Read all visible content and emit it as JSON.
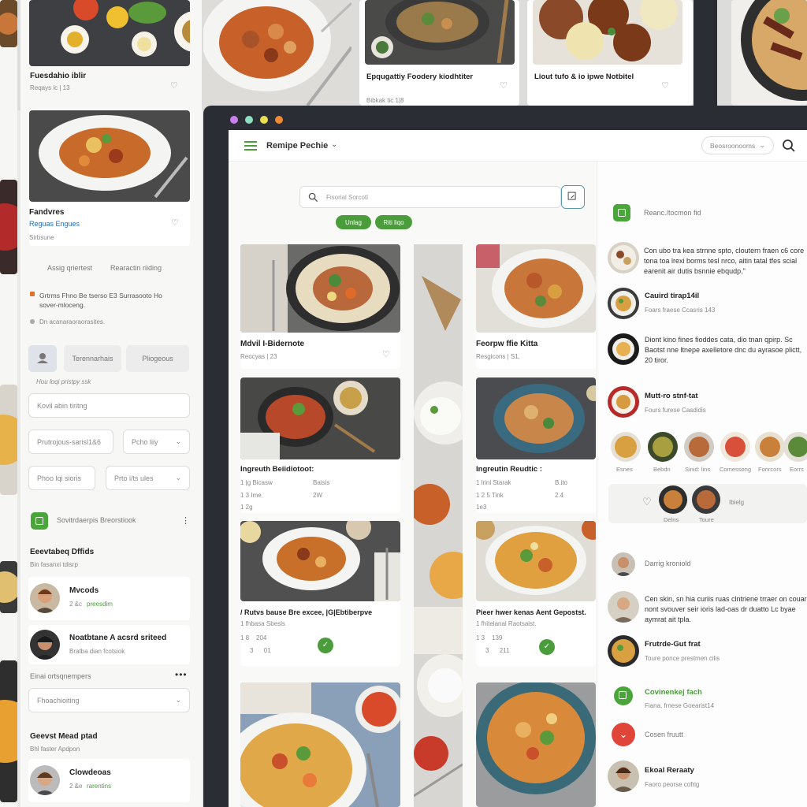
{
  "top_cards": [
    {
      "title": "Fuesdahio iblir",
      "meta": "Reqays ic  |  13"
    },
    {
      "title": "Epqugattiy Foodery kiodhtiter",
      "meta": "Bibkak tic 1|8"
    },
    {
      "title": "Liout tufo & io ipwe Notbitel",
      "meta": ""
    }
  ],
  "left_panel": {
    "card_title": "Fandvres",
    "card_tags": "Reguas  Engues",
    "card_sub": "Sirbsune",
    "tabs": [
      "Assig  qriertest",
      "Rearactin riiding"
    ],
    "line1": "Grtrms Fhno Be tserso E3 Surrasooto Ho sover-mloceng.",
    "line2": "Dn acanaraoraorasites.",
    "btn_a": "Terennarhais",
    "btn_b": "Pliogeous",
    "section_label": "Hou loqi pristpy ssk",
    "input1": "Kovil abin tiritng",
    "select_a": "Prutrojous-sarisl1&6",
    "select_b": "Pcho liiy",
    "select_c": "Phoo lqi sioris",
    "select_d": "Prto i/ts ules",
    "feed_title": "Sovitrdaerpis Breorstiook",
    "section2": "Eeevtabeq Dffids",
    "section2_sub": "Bin fasanxi tdisrp",
    "people": [
      {
        "name": "Mvcods",
        "sub": "2 &c",
        "tag": "preesdim"
      },
      {
        "name": "Noatbtane A acsrd sriteed",
        "sub": "Bratba dian fcotsiok",
        "tag": ""
      }
    ],
    "section3": "Einai ortsqnempers",
    "select_e": "Fhoachioiting",
    "section4": "Geevst Mead ptad",
    "section4_sub": "Bhl faster Apdpon",
    "person3": {
      "name": "Clowdeoas",
      "sub": "2 &e",
      "tag": "rarentins"
    }
  },
  "app": {
    "title": "Remipe Pechie",
    "sort_label": "Beosroonooms",
    "search_placeholder": "Fisorial Sorcotl",
    "filters": [
      "Unlag",
      "Riti liqo"
    ]
  },
  "recipes": [
    {
      "title": "Mdvil I-Bidernote",
      "meta1": "Reocyas  |  23"
    },
    {
      "title": "Feorpw ffie Kitta",
      "meta1": "Resgicons  |  S1,"
    },
    {
      "title": "Ingreuth Beiidiotoot:",
      "l1": "1 |g Bicasw",
      "l2": "1 3     Ime",
      "l3": "1 2g",
      "r1": "Baisis",
      "r2": "2W"
    },
    {
      "title": "Ingreutin Reudtic :",
      "l1": "1 lrinl Starak",
      "l2": "1 2 5     Tink",
      "l3": "1e3",
      "r1": "B.ito",
      "r2": "2.4"
    },
    {
      "title": "/ Rutvs bause Bre excee, |G|Ebtiberpve",
      "l1": "1 fhbasa Sbesls",
      "l2": "1 8    204",
      "l3": "3      01",
      "r1": "",
      "r2": ""
    },
    {
      "title": "Pieer hwer kenas Aent Gepostst.",
      "l1": "1 fhitelanal Raotsaist.",
      "l2": "1 3    139",
      "l3": "3      211",
      "r1": "",
      "r2": ""
    }
  ],
  "right_panel": {
    "header": "Reanc./tocmon fid",
    "comments": [
      {
        "text": "Con ubo tra kea strnne spto, cloutern fraen  c6 core tona toa lrexi borms tesl nrco, aitin tatal tfes scial earenit air dutis bsnnie ebqudp.\""
      },
      {
        "name": "Cauird tirap14il",
        "sub": "Foars  fraese Ccasris 143"
      },
      {
        "text": "Diont kino fines fioddes cata, dio tnan qpirp. Sc Baotst nne ltnepe axelletore dnc du ayrasoe plictt, 20 tiror."
      },
      {
        "name": "Mutt-ro stnf-tat",
        "sub": "Fours  furese Casdidis"
      }
    ],
    "avatar_labels": [
      "Esnes",
      "Bebdn",
      "Sinid: lins",
      "Comessong",
      "Fonrcors",
      "Eorrs"
    ],
    "like_row": [
      "Delns",
      "Toure",
      "Ibielg"
    ],
    "people": [
      {
        "name": "Darrig kroniold",
        "sub": ""
      },
      {
        "text": "Cen skin, sn hia curiis ruas clntriene trraer on couar nont svouver seir ioris lad-oas dr duatto  Lc byae aymrat ait tpla."
      },
      {
        "name": "Frutrde-Gut frat",
        "sub": "Toure ponce prestmen cilis"
      },
      {
        "name": "Covinenkej fach",
        "sub": "Fiana, frnese Goearist14",
        "green": true
      },
      {
        "name": "Cosen fruutt",
        "sub": ""
      },
      {
        "name": "Ekoal Reraaty",
        "sub": "Faoro  peorse cofrig"
      }
    ]
  },
  "colors": {
    "accent": "#4a9d3a",
    "dark_bezel": "#2a2d33",
    "red": "#e0453a"
  }
}
